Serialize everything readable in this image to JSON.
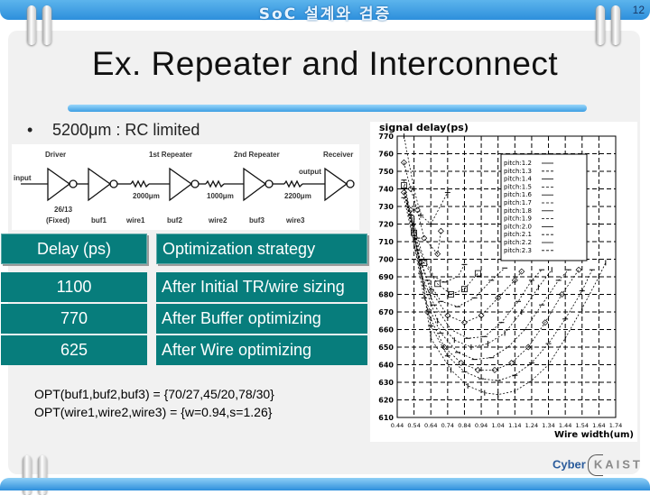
{
  "header": {
    "title": "SoC 설계와 검증",
    "page_number": "12"
  },
  "slide": {
    "title": "Ex. Repeater and Interconnect",
    "bullet": "5200μm : RC limited"
  },
  "diagram": {
    "stage_labels": [
      "Driver",
      "1st Repeater",
      "2nd Repeater",
      "Receiver"
    ],
    "input_label": "input",
    "output_label": "output",
    "wire_lengths": [
      "2000μm",
      "1000μm",
      "2200μm"
    ],
    "driver_size": "26/13",
    "driver_note": "(Fixed)",
    "bottom_labels": [
      "buf1",
      "wire1",
      "buf2",
      "wire2",
      "buf3",
      "wire3"
    ]
  },
  "table": {
    "headers": [
      "Delay (ps)",
      "Optimization strategy"
    ],
    "rows": [
      {
        "delay": "1100",
        "strategy": "After Initial TR/wire sizing"
      },
      {
        "delay": "770",
        "strategy": "After Buffer optimizing"
      },
      {
        "delay": "625",
        "strategy": "After Wire optimizing"
      }
    ]
  },
  "opt_lines": [
    "OPT(buf1,buf2,buf3) = {70/27,45/20,78/30}",
    "OPT(wire1,wire2,wire3) = {w=0.94,s=1.26}"
  ],
  "logo": {
    "part1": "Cyber",
    "part2": "KAIST"
  },
  "chart_data": {
    "type": "line",
    "title": "signal delay(ps)",
    "xlabel": "Wire width(um)",
    "ylabel": "signal delay(ps)",
    "xlim": [
      0.44,
      1.74
    ],
    "ylim": [
      610,
      770
    ],
    "x_ticks": [
      "0.44",
      "0.54",
      "0.64",
      "0.74",
      "0.84",
      "0.94",
      "1.04",
      "1.14",
      "1.24",
      "1.34",
      "1.44",
      "1.54",
      "1.64",
      "1.74"
    ],
    "y_ticks": [
      "770",
      "760",
      "750",
      "740",
      "730",
      "720",
      "710",
      "700",
      "690",
      "680",
      "670",
      "660",
      "650",
      "640",
      "630",
      "620",
      "610"
    ],
    "grid": true,
    "legend_position": "top-right",
    "series": [
      {
        "name": "pitch:1.2",
        "x": [
          0.48,
          0.54,
          0.58,
          0.64,
          0.74
        ],
        "y": [
          770,
          740,
          725,
          720,
          738
        ]
      },
      {
        "name": "pitch:1.3",
        "x": [
          0.48,
          0.52,
          0.56,
          0.6,
          0.68,
          0.7
        ],
        "y": [
          755,
          740,
          728,
          712,
          703,
          716
        ]
      },
      {
        "name": "pitch:1.4",
        "x": [
          0.48,
          0.52,
          0.56,
          0.6,
          0.66,
          0.72,
          0.8,
          0.84
        ],
        "y": [
          745,
          725,
          712,
          700,
          690,
          687,
          690,
          697
        ]
      },
      {
        "name": "pitch:1.5",
        "x": [
          0.48,
          0.54,
          0.6,
          0.68,
          0.76,
          0.84,
          0.92
        ],
        "y": [
          742,
          715,
          698,
          686,
          680,
          683,
          692
        ]
      },
      {
        "name": "pitch:1.6",
        "x": [
          0.48,
          0.56,
          0.62,
          0.7,
          0.8,
          0.9,
          1.0,
          1.08
        ],
        "y": [
          740,
          705,
          688,
          676,
          673,
          678,
          688,
          695
        ]
      },
      {
        "name": "pitch:1.7",
        "x": [
          0.48,
          0.58,
          0.64,
          0.74,
          0.84,
          0.94,
          1.04,
          1.14,
          1.18
        ],
        "y": [
          738,
          698,
          682,
          668,
          664,
          668,
          678,
          688,
          693
        ]
      },
      {
        "name": "pitch:1.8",
        "x": [
          0.48,
          0.58,
          0.66,
          0.76,
          0.86,
          0.96,
          1.06,
          1.16,
          1.24,
          1.3
        ],
        "y": [
          735,
          692,
          674,
          660,
          655,
          656,
          664,
          676,
          688,
          694
        ]
      },
      {
        "name": "pitch:1.9",
        "x": [
          0.5,
          0.6,
          0.68,
          0.78,
          0.88,
          0.98,
          1.08,
          1.18,
          1.28,
          1.36
        ],
        "y": [
          732,
          685,
          665,
          654,
          650,
          652,
          658,
          670,
          684,
          694
        ]
      },
      {
        "name": "pitch:2.0",
        "x": [
          0.5,
          0.6,
          0.7,
          0.8,
          0.9,
          1.0,
          1.1,
          1.2,
          1.3,
          1.4,
          1.46
        ],
        "y": [
          730,
          678,
          658,
          647,
          643,
          644,
          650,
          660,
          674,
          688,
          694
        ]
      },
      {
        "name": "pitch:2.1",
        "x": [
          0.52,
          0.62,
          0.72,
          0.82,
          0.92,
          1.02,
          1.12,
          1.22,
          1.32,
          1.42,
          1.52
        ],
        "y": [
          728,
          670,
          650,
          641,
          637,
          637,
          641,
          650,
          664,
          680,
          694
        ]
      },
      {
        "name": "pitch:2.2",
        "x": [
          0.52,
          0.64,
          0.74,
          0.84,
          0.94,
          1.04,
          1.14,
          1.24,
          1.34,
          1.44,
          1.54,
          1.6
        ],
        "y": [
          725,
          662,
          645,
          636,
          632,
          631,
          634,
          641,
          652,
          666,
          682,
          694
        ]
      },
      {
        "name": "pitch:2.3",
        "x": [
          0.54,
          0.64,
          0.76,
          0.86,
          0.96,
          1.04,
          1.14,
          1.24,
          1.34,
          1.44,
          1.54,
          1.64,
          1.68
        ],
        "y": [
          722,
          655,
          637,
          628,
          624,
          623,
          625,
          631,
          640,
          655,
          672,
          690,
          698
        ]
      }
    ]
  }
}
